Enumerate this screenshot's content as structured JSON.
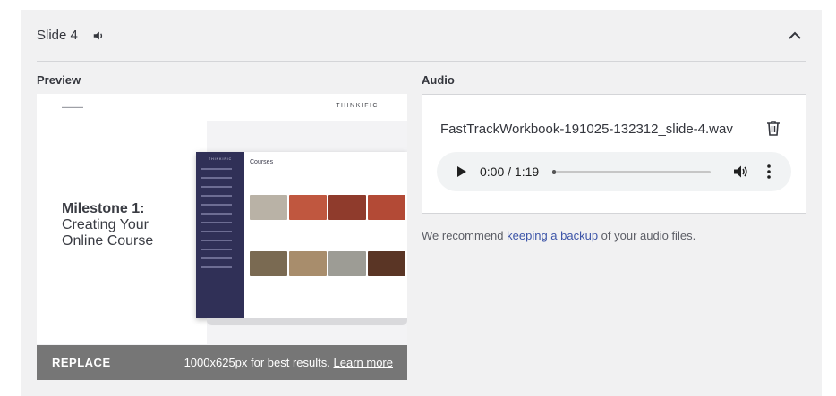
{
  "slide": {
    "title": "Slide 4"
  },
  "preview": {
    "label": "Preview",
    "brand": "THINKIFIC",
    "milestone_line1": "Milestone 1:",
    "milestone_line2": "Creating Your",
    "milestone_line3": "Online Course",
    "courses_heading": "Courses",
    "replace_label": "REPLACE",
    "hint_text": "1000x625px for best results.",
    "hint_link": "Learn more"
  },
  "audio": {
    "label": "Audio",
    "filename": "FastTrackWorkbook-191025-132312_slide-4.wav",
    "time": "0:00 / 1:19",
    "progress_fraction": 0.0
  },
  "note": {
    "before": "We recommend ",
    "link": "keeping a backup",
    "after": " of your audio files."
  },
  "colors": {
    "panel_bg": "#f1f1f2",
    "link": "#3d55a8",
    "sidebar": "#303057"
  },
  "icons": {
    "speaker": "speaker-icon",
    "collapse": "chevron-up-icon",
    "trash": "trash-icon",
    "play": "play-icon",
    "volume": "volume-icon",
    "more": "more-vertical-icon"
  }
}
